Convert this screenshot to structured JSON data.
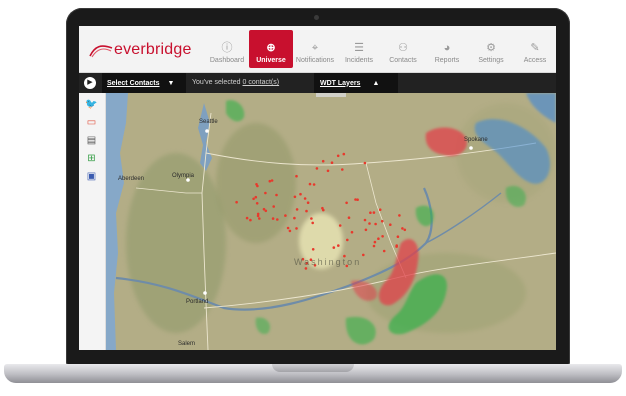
{
  "app": {
    "logo_text": "everbridge",
    "brand_color": "#c8102e"
  },
  "nav": {
    "active": "Universe",
    "items": [
      {
        "label": "Dashboard",
        "icon": "dashboard-icon"
      },
      {
        "label": "Universe",
        "icon": "globe-icon"
      },
      {
        "label": "Notifications",
        "icon": "broadcast-icon"
      },
      {
        "label": "Incidents",
        "icon": "list-icon"
      },
      {
        "label": "Contacts",
        "icon": "contacts-icon"
      },
      {
        "label": "Reports",
        "icon": "pie-chart-icon"
      },
      {
        "label": "Settings",
        "icon": "gear-icon"
      },
      {
        "label": "Access",
        "icon": "wrench-icon"
      }
    ]
  },
  "toolbar": {
    "select_contacts": "Select Contacts",
    "selected_prefix": "You've selected ",
    "selected_link": "0 contact(s)",
    "wdt_layers": "WDT Layers"
  },
  "sidebar": {
    "icons": [
      "twitter-icon",
      "chat-icon",
      "bus-icon",
      "network-icon",
      "badge-icon"
    ]
  },
  "map": {
    "labels": {
      "seattle": "Seattle",
      "olympia": "Olympia",
      "aberdeen": "Aberdeen",
      "portland": "Portland",
      "salem": "Salem",
      "spokane": "Spokane",
      "washington": "Washington"
    },
    "colors": {
      "incident_dot": "#e8392c",
      "weather_red": "#e0404a",
      "weather_green": "#32b04a",
      "weather_blue": "#3a86d8"
    }
  }
}
